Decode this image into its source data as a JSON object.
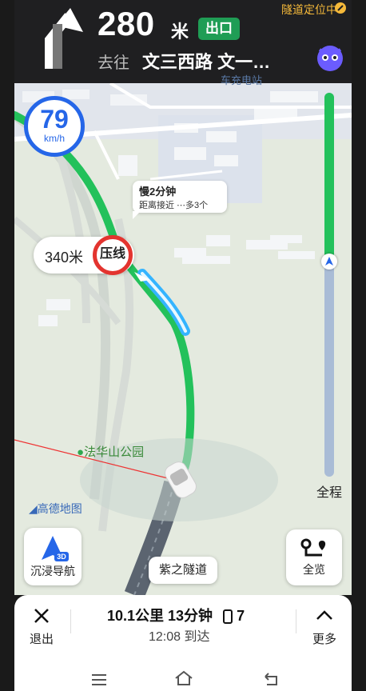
{
  "banner": {
    "distance_value": "280",
    "distance_unit": "米",
    "exit_badge": "出口",
    "tunnel_status": "隧道定位中",
    "goto_prefix": "去往",
    "goto_road": "文三西路 文一…"
  },
  "speed": {
    "value": "79",
    "unit": "km/h"
  },
  "traffic_bubble": {
    "line1": "慢2分钟",
    "line2": "距离接近 ⋯多3个"
  },
  "camera": {
    "distance": "340米",
    "type": "压线"
  },
  "map_labels": {
    "park": "法华山公园",
    "station": "车充电站",
    "logo": "高德地图"
  },
  "progress": {
    "label": "全程",
    "fraction": 0.44
  },
  "buttons": {
    "immersive_nav": "沉浸导航",
    "overview": "全览",
    "road_name": "紫之隧道"
  },
  "trip": {
    "distance_time": "10.1公里 13分钟",
    "lights": "7",
    "arrival": "12:08 到达"
  },
  "bottom_buttons": {
    "exit": "退出",
    "more": "更多"
  },
  "colors": {
    "accent": "#2566e8",
    "route_green": "#23c15b",
    "camera_red": "#e3342f",
    "exit_green": "#1f9d55"
  }
}
